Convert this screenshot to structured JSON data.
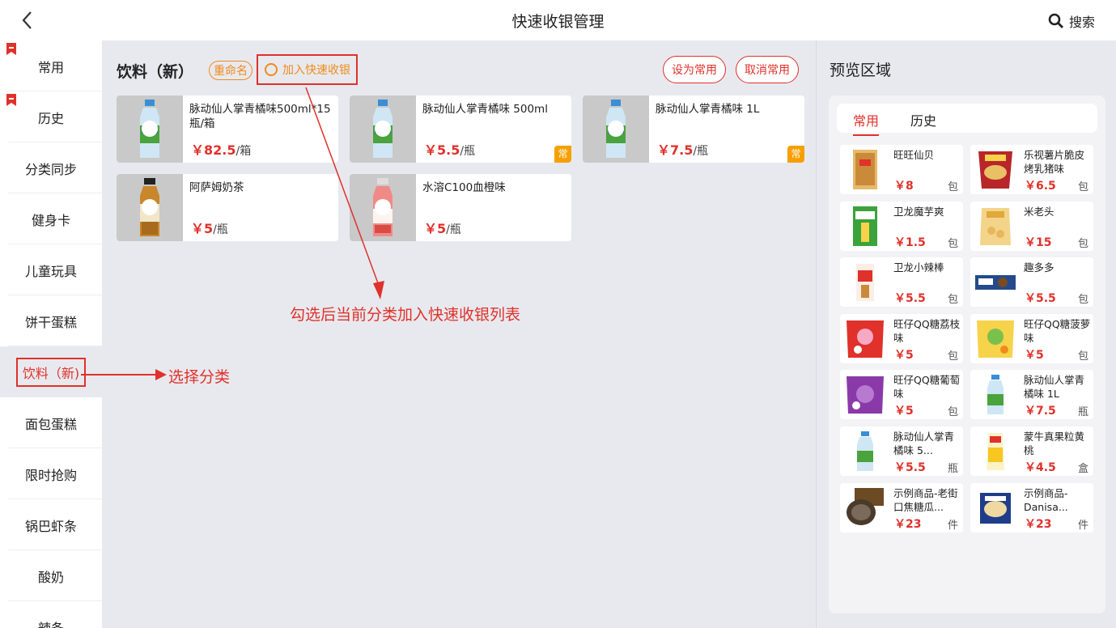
{
  "header": {
    "title": "快速收银管理",
    "search_label": "搜索"
  },
  "sidebar": {
    "items": [
      {
        "label": "常用",
        "bookmarked": true
      },
      {
        "label": "历史",
        "bookmarked": true
      },
      {
        "label": "分类同步"
      },
      {
        "label": "健身卡"
      },
      {
        "label": "儿童玩具"
      },
      {
        "label": "饼干蛋糕"
      },
      {
        "label": "饮料（新)",
        "active": true
      },
      {
        "label": "面包蛋糕"
      },
      {
        "label": "限时抢购"
      },
      {
        "label": "锅巴虾条"
      },
      {
        "label": "酸奶"
      },
      {
        "label": "辣条"
      }
    ]
  },
  "main": {
    "category_title": "饮料（新）",
    "rename_label": "重命名",
    "quick_add_label": "加入快速收银",
    "set_common_label": "设为常用",
    "cancel_common_label": "取消常用",
    "products": [
      {
        "name": "脉动仙人掌青橘味500ml*15瓶/箱",
        "price": "￥82.5",
        "unit": "/箱",
        "common": false,
        "img": "bottle-green"
      },
      {
        "name": "脉动仙人掌青橘味 500ml",
        "price": "￥5.5",
        "unit": "/瓶",
        "common": true,
        "badge": "常",
        "img": "bottle-green"
      },
      {
        "name": "脉动仙人掌青橘味 1L",
        "price": "￥7.5",
        "unit": "/瓶",
        "common": true,
        "badge": "常",
        "img": "bottle-green"
      },
      {
        "name": "阿萨姆奶茶",
        "price": "￥5",
        "unit": "/瓶",
        "common": false,
        "img": "bottle-brown"
      },
      {
        "name": "水溶C100血橙味",
        "price": "￥5",
        "unit": "/瓶",
        "common": false,
        "img": "bottle-pink"
      }
    ]
  },
  "annotations": {
    "quick_add_note": "勾选后当前分类加入快速收银列表",
    "select_category_note": "选择分类"
  },
  "preview": {
    "title": "预览区域",
    "tabs": [
      "常用",
      "历史"
    ],
    "items": [
      {
        "name": "旺旺仙贝",
        "price": "￥8",
        "unit": "包"
      },
      {
        "name": "乐视薯片脆皮烤乳猪味",
        "price": "￥6.5",
        "unit": "包"
      },
      {
        "name": "卫龙魔芋爽",
        "price": "￥1.5",
        "unit": "包"
      },
      {
        "name": "米老头",
        "price": "￥15",
        "unit": "包"
      },
      {
        "name": "卫龙小辣棒",
        "price": "￥5.5",
        "unit": "包"
      },
      {
        "name": "趣多多",
        "price": "￥5.5",
        "unit": "包"
      },
      {
        "name": "旺仔QQ糖荔枝味",
        "price": "￥5",
        "unit": "包"
      },
      {
        "name": "旺仔QQ糖菠萝味",
        "price": "￥5",
        "unit": "包"
      },
      {
        "name": "旺仔QQ糖葡萄味",
        "price": "￥5",
        "unit": "包"
      },
      {
        "name": "脉动仙人掌青橘味 1L",
        "price": "￥7.5",
        "unit": "瓶"
      },
      {
        "name": "脉动仙人掌青橘味 5...",
        "price": "￥5.5",
        "unit": "瓶"
      },
      {
        "name": "蒙牛真果粒黄桃",
        "price": "￥4.5",
        "unit": "盒"
      },
      {
        "name": "示例商品-老街口焦糖瓜...",
        "price": "￥23",
        "unit": "件"
      },
      {
        "name": "示例商品-Danisa...",
        "price": "￥23",
        "unit": "件"
      }
    ]
  },
  "colors": {
    "accent": "#e0312b",
    "orange": "#f08a1c",
    "badge": "#f5a000",
    "panel_bg": "#e8e9ee"
  }
}
